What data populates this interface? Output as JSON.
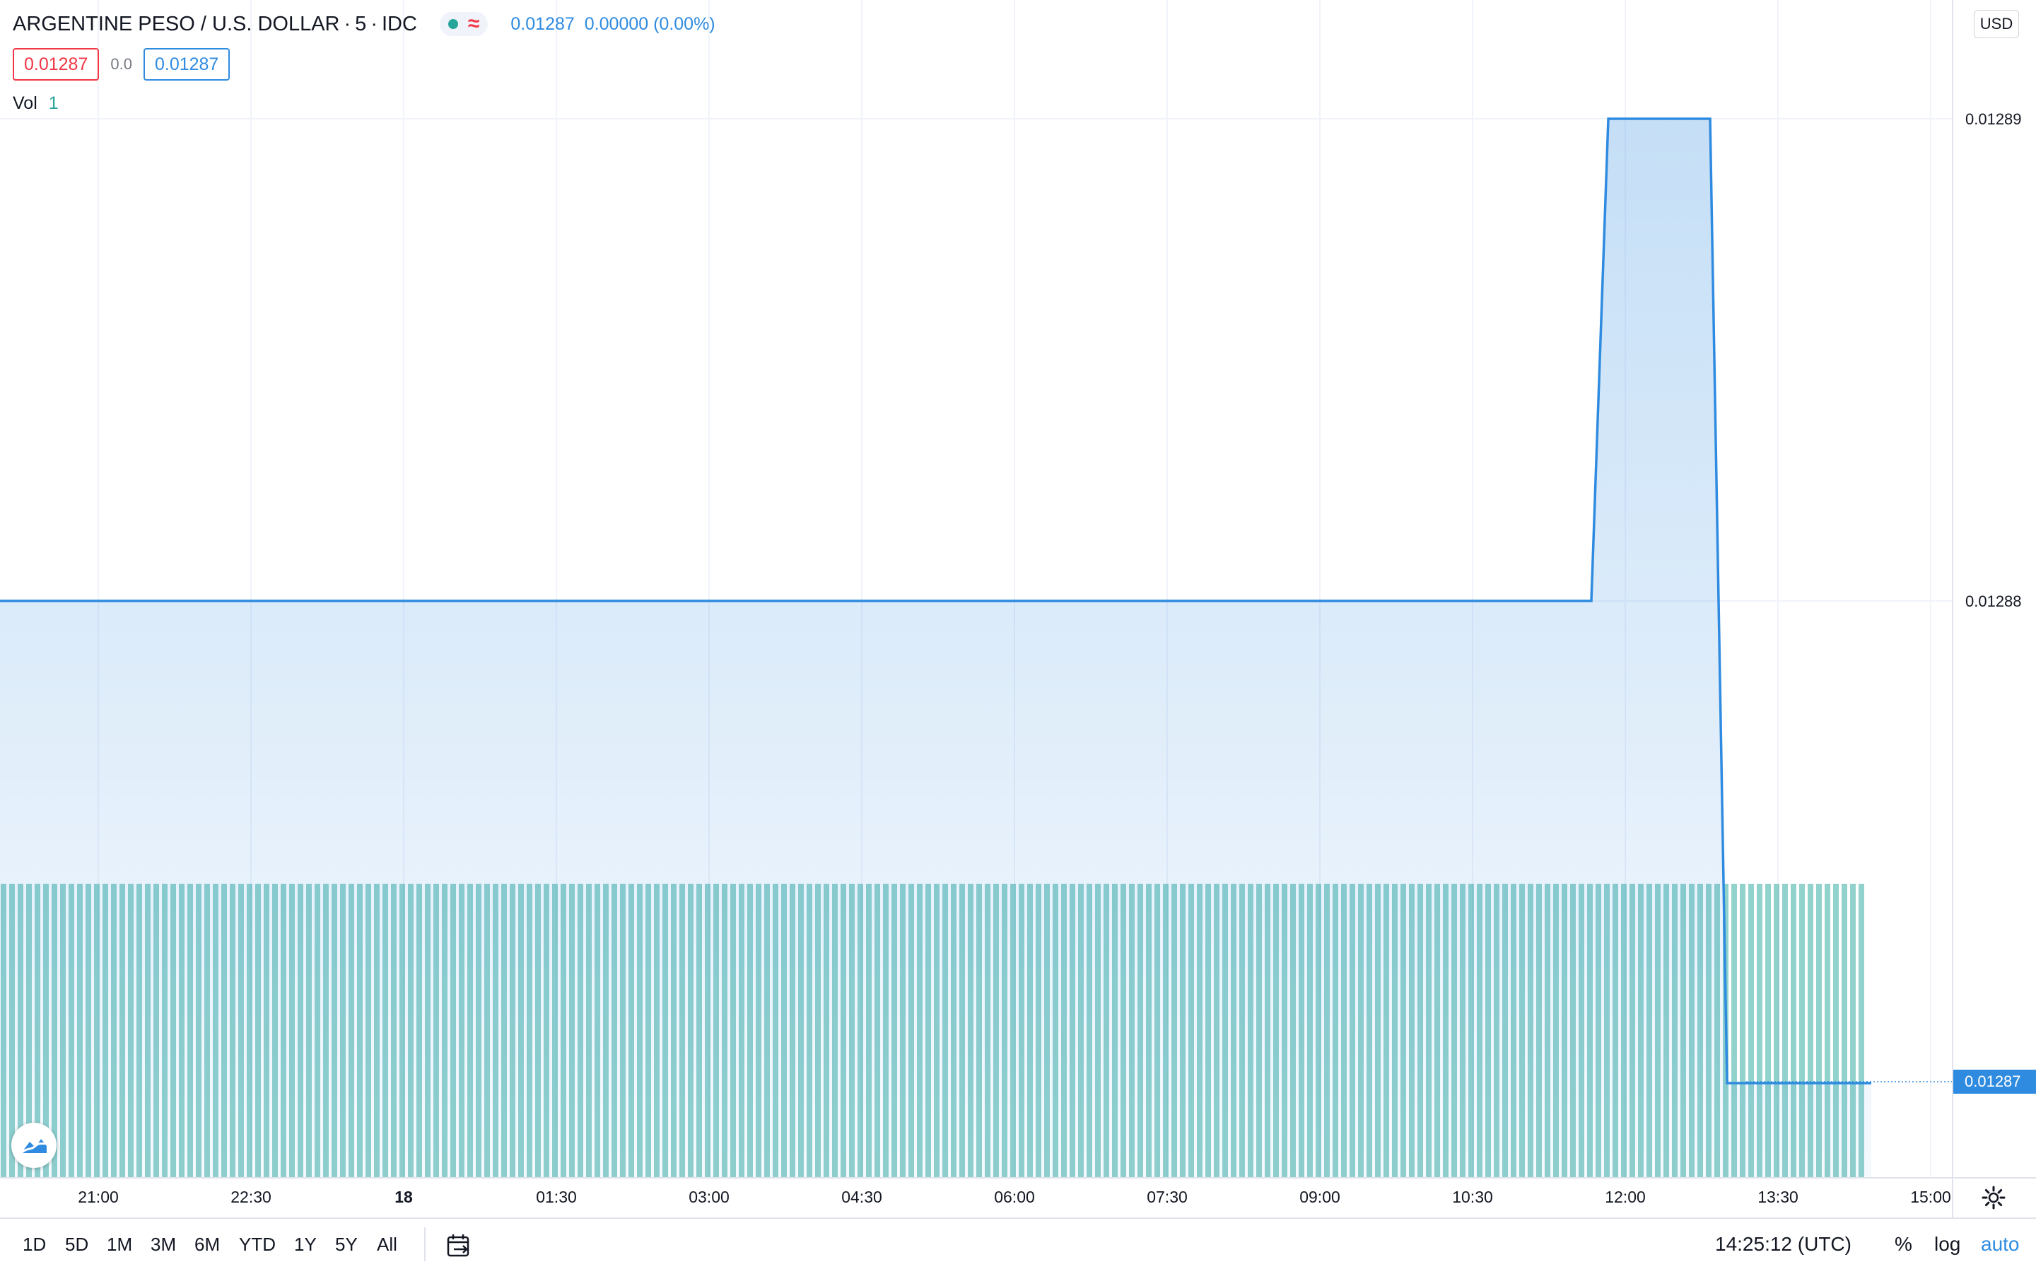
{
  "legend": {
    "symbol": "ARGENTINE PESO / U.S. DOLLAR",
    "interval": "5",
    "exchange": "IDC",
    "dot_separator": "·",
    "market_icon": "≈",
    "last_price": "0.01287",
    "change": "0.00000 (0.00%)",
    "bid": "0.01287",
    "spread": "0.0",
    "ask": "0.01287",
    "volume_label": "Vol",
    "volume_value": "1"
  },
  "price_scale": {
    "currency": "USD",
    "labels": [
      "0.01289",
      "0.01288"
    ],
    "current_price": "0.01287"
  },
  "time_scale": {
    "labels": [
      "21:00",
      "22:30",
      "18",
      "01:30",
      "03:00",
      "04:30",
      "06:00",
      "07:30",
      "09:00",
      "10:30",
      "12:00",
      "13:30",
      "15:00"
    ],
    "bold_label": "18"
  },
  "bottom_bar": {
    "ranges": [
      "1D",
      "5D",
      "1M",
      "3M",
      "6M",
      "YTD",
      "1Y",
      "5Y",
      "All"
    ],
    "clock": "14:25:12 (UTC)",
    "percent_label": "%",
    "log_label": "log",
    "auto_label": "auto"
  },
  "colors": {
    "line": "#2f8be0",
    "volume": "#26a69a",
    "down": "#f23645"
  },
  "icons": {
    "logo": "tradingview-logo-icon",
    "settings": "gear-icon",
    "goto_date": "calendar-arrow-icon"
  },
  "chart_data": {
    "type": "area",
    "series": [
      {
        "values_description_free": true,
        "x": [
          "20:25",
          "11:40",
          "11:50",
          "12:50",
          "13:00",
          "14:25"
        ],
        "values": [
          0.01288,
          0.01288,
          0.01289,
          0.01289,
          0.01287,
          0.01287
        ]
      }
    ],
    "volume_per_bar": 1,
    "ylim": [
      0.012866,
      0.012892
    ],
    "log_scale": false,
    "grid": true
  }
}
